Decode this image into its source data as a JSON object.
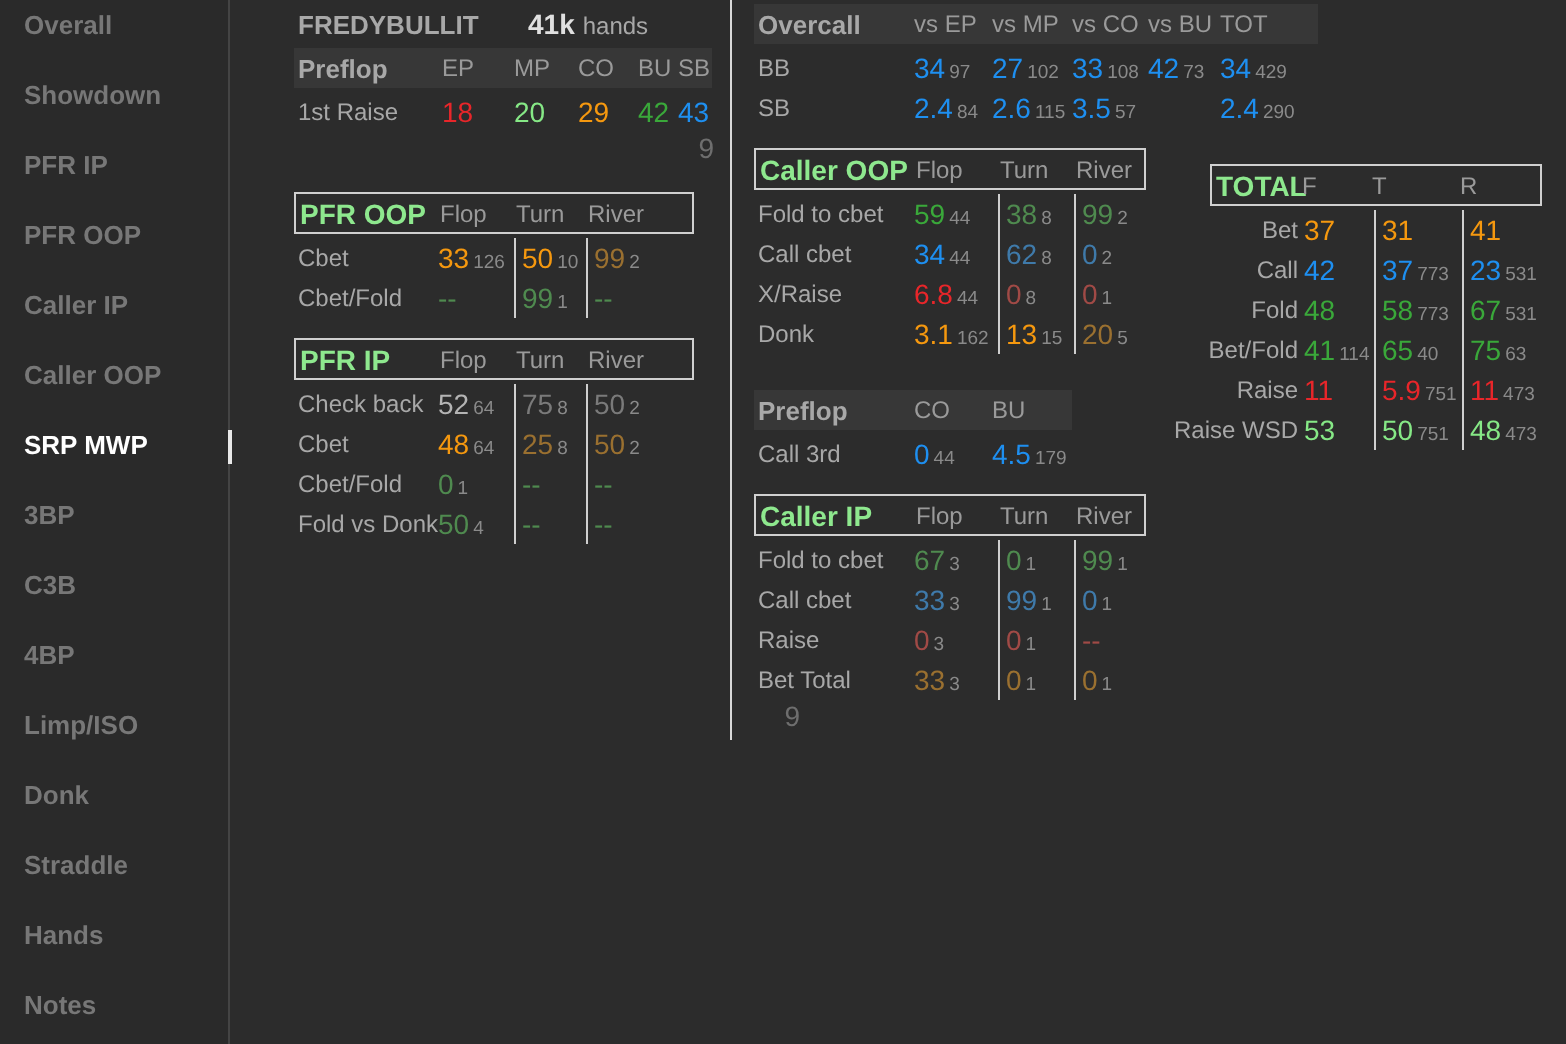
{
  "sidebar": {
    "items": [
      {
        "label": "Overall",
        "selected": false
      },
      {
        "label": "Showdown",
        "selected": false
      },
      {
        "label": "PFR IP",
        "selected": false
      },
      {
        "label": "PFR OOP",
        "selected": false
      },
      {
        "label": "Caller IP",
        "selected": false
      },
      {
        "label": "Caller OOP",
        "selected": false
      },
      {
        "label": "SRP MWP",
        "selected": true
      },
      {
        "label": "3BP",
        "selected": false
      },
      {
        "label": "C3B",
        "selected": false
      },
      {
        "label": "4BP",
        "selected": false
      },
      {
        "label": "Limp/ISO",
        "selected": false
      },
      {
        "label": "Donk",
        "selected": false
      },
      {
        "label": "Straddle",
        "selected": false
      },
      {
        "label": "Hands",
        "selected": false
      },
      {
        "label": "Notes",
        "selected": false
      }
    ]
  },
  "player": {
    "name": "FREDYBULLIT",
    "hands_count": "41k",
    "hands_label": "hands"
  },
  "columns": [
    {
      "sections": [
        {
          "kind": "grid",
          "title": "Preflop",
          "columns": [
            "EP",
            "MP",
            "CO",
            "BU",
            "SB"
          ],
          "rows": [
            {
              "label": "1st Raise",
              "cells": [
                {
                  "value": "18",
                  "color": "#e8262a"
                },
                {
                  "value": "20",
                  "color": "#86e886"
                },
                {
                  "value": "29",
                  "color": "#f5980f"
                },
                {
                  "value": "42",
                  "color": "#3aa83a"
                },
                {
                  "value": "43",
                  "color": "#1e8ff0"
                }
              ]
            }
          ]
        },
        {
          "kind": "stray",
          "text": "9"
        },
        {
          "kind": "street",
          "title": "PFR OOP",
          "columns": [
            "Flop",
            "Turn",
            "River"
          ],
          "rows": [
            {
              "label": "Cbet",
              "cells": [
                {
                  "value": "33",
                  "sample": "126",
                  "color": "#f5980f"
                },
                {
                  "value": "50",
                  "sample": "10",
                  "color": "#f5980f"
                },
                {
                  "value": "99",
                  "sample": "2",
                  "color": "#9a7030"
                }
              ]
            },
            {
              "label": "Cbet/Fold",
              "cells": [
                {
                  "value": "--",
                  "color": "#4f8a4f"
                },
                {
                  "value": "99",
                  "sample": "1",
                  "color": "#4f8a4f"
                },
                {
                  "value": "--",
                  "color": "#4f8a4f"
                }
              ]
            }
          ]
        },
        {
          "kind": "street",
          "title": "PFR IP",
          "columns": [
            "Flop",
            "Turn",
            "River"
          ],
          "rows": [
            {
              "label": "Check back",
              "cells": [
                {
                  "value": "52",
                  "sample": "64",
                  "color": "#b4b4b4"
                },
                {
                  "value": "75",
                  "sample": "8",
                  "color": "#7a7a7a"
                },
                {
                  "value": "50",
                  "sample": "2",
                  "color": "#7a7a7a"
                }
              ]
            },
            {
              "label": "Cbet",
              "cells": [
                {
                  "value": "48",
                  "sample": "64",
                  "color": "#f5980f"
                },
                {
                  "value": "25",
                  "sample": "8",
                  "color": "#9a7030"
                },
                {
                  "value": "50",
                  "sample": "2",
                  "color": "#9a7030"
                }
              ]
            },
            {
              "label": "Cbet/Fold",
              "cells": [
                {
                  "value": "0",
                  "sample": "1",
                  "color": "#4f8a4f"
                },
                {
                  "value": "--",
                  "color": "#4f8a4f"
                },
                {
                  "value": "--",
                  "color": "#4f8a4f"
                }
              ]
            },
            {
              "label": "Fold vs Donk",
              "cells": [
                {
                  "value": "50",
                  "sample": "4",
                  "color": "#4f8a4f"
                },
                {
                  "value": "--",
                  "color": "#4f8a4f"
                },
                {
                  "value": "--",
                  "color": "#4f8a4f"
                }
              ]
            }
          ]
        }
      ]
    },
    {
      "sections": [
        {
          "kind": "grid",
          "title": "Overcall",
          "columns": [
            "vs EP",
            "vs MP",
            "vs CO",
            "vs BU",
            "TOT"
          ],
          "rows": [
            {
              "label": "BB",
              "cells": [
                {
                  "value": "34",
                  "sample": "97",
                  "color": "#1e8ff0"
                },
                {
                  "value": "27",
                  "sample": "102",
                  "color": "#1e8ff0"
                },
                {
                  "value": "33",
                  "sample": "108",
                  "color": "#1e8ff0"
                },
                {
                  "value": "42",
                  "sample": "73",
                  "color": "#1e8ff0"
                },
                {
                  "value": "34",
                  "sample": "429",
                  "color": "#1e8ff0"
                }
              ]
            },
            {
              "label": "SB",
              "cells": [
                {
                  "value": "2.4",
                  "sample": "84",
                  "color": "#1e8ff0"
                },
                {
                  "value": "2.6",
                  "sample": "115",
                  "color": "#1e8ff0"
                },
                {
                  "value": "3.5",
                  "sample": "57",
                  "color": "#1e8ff0"
                },
                null,
                {
                  "value": "2.4",
                  "sample": "290",
                  "color": "#1e8ff0"
                }
              ]
            }
          ]
        },
        {
          "kind": "street",
          "title": "Caller OOP",
          "columns": [
            "Flop",
            "Turn",
            "River"
          ],
          "rows": [
            {
              "label": "Fold to cbet",
              "cells": [
                {
                  "value": "59",
                  "sample": "44",
                  "color": "#3aa83a"
                },
                {
                  "value": "38",
                  "sample": "8",
                  "color": "#4f8a4f"
                },
                {
                  "value": "99",
                  "sample": "2",
                  "color": "#4f8a4f"
                }
              ]
            },
            {
              "label": "Call cbet",
              "cells": [
                {
                  "value": "34",
                  "sample": "44",
                  "color": "#1e8ff0"
                },
                {
                  "value": "62",
                  "sample": "8",
                  "color": "#3f7aaa"
                },
                {
                  "value": "0",
                  "sample": "2",
                  "color": "#3f7aaa"
                }
              ]
            },
            {
              "label": "X/Raise",
              "cells": [
                {
                  "value": "6.8",
                  "sample": "44",
                  "color": "#e8262a"
                },
                {
                  "value": "0",
                  "sample": "8",
                  "color": "#a04a46"
                },
                {
                  "value": "0",
                  "sample": "1",
                  "color": "#a04a46"
                }
              ]
            },
            {
              "label": "Donk",
              "cells": [
                {
                  "value": "3.1",
                  "sample": "162",
                  "color": "#f5980f"
                },
                {
                  "value": "13",
                  "sample": "15",
                  "color": "#f5980f"
                },
                {
                  "value": "20",
                  "sample": "5",
                  "color": "#9a7030"
                }
              ]
            }
          ]
        },
        {
          "kind": "grid",
          "title": "Preflop",
          "columns": [
            "CO",
            "BU"
          ],
          "rows": [
            {
              "label": "Call 3rd",
              "cells": [
                {
                  "value": "0",
                  "sample": "44",
                  "color": "#1e8ff0"
                },
                {
                  "value": "4.5",
                  "sample": "179",
                  "color": "#1e8ff0"
                }
              ]
            }
          ]
        },
        {
          "kind": "street",
          "title": "Caller IP",
          "columns": [
            "Flop",
            "Turn",
            "River"
          ],
          "rows": [
            {
              "label": "Fold to cbet",
              "cells": [
                {
                  "value": "67",
                  "sample": "3",
                  "color": "#4f8a4f"
                },
                {
                  "value": "0",
                  "sample": "1",
                  "color": "#4f8a4f"
                },
                {
                  "value": "99",
                  "sample": "1",
                  "color": "#4f8a4f"
                }
              ]
            },
            {
              "label": "Call cbet",
              "cells": [
                {
                  "value": "33",
                  "sample": "3",
                  "color": "#3f7aaa"
                },
                {
                  "value": "99",
                  "sample": "1",
                  "color": "#3f7aaa"
                },
                {
                  "value": "0",
                  "sample": "1",
                  "color": "#3f7aaa"
                }
              ]
            },
            {
              "label": "Raise",
              "cells": [
                {
                  "value": "0",
                  "sample": "3",
                  "color": "#a04a46"
                },
                {
                  "value": "0",
                  "sample": "1",
                  "color": "#a04a46"
                },
                {
                  "value": "--",
                  "color": "#a04a46"
                }
              ]
            },
            {
              "label": "Bet Total",
              "cells": [
                {
                  "value": "33",
                  "sample": "3",
                  "color": "#9a7030"
                },
                {
                  "value": "0",
                  "sample": "1",
                  "color": "#9a7030"
                },
                {
                  "value": "0",
                  "sample": "1",
                  "color": "#9a7030"
                }
              ]
            }
          ]
        },
        {
          "kind": "stray",
          "text": "9"
        }
      ]
    },
    {
      "sections": [
        {
          "kind": "total",
          "title": "TOTAL",
          "columns": [
            "F",
            "T",
            "R"
          ],
          "rows": [
            {
              "label": "Bet",
              "cells": [
                {
                  "value": "37",
                  "color": "#f5980f"
                },
                {
                  "value": "31",
                  "color": "#f5980f"
                },
                {
                  "value": "41",
                  "color": "#f5980f"
                }
              ]
            },
            {
              "label": "Call",
              "cells": [
                {
                  "value": "42",
                  "color": "#1e8ff0"
                },
                {
                  "value": "37",
                  "sample": "773",
                  "color": "#1e8ff0"
                },
                {
                  "value": "23",
                  "sample": "531",
                  "color": "#1e8ff0"
                }
              ]
            },
            {
              "label": "Fold",
              "cells": [
                {
                  "value": "48",
                  "color": "#3aa83a"
                },
                {
                  "value": "58",
                  "sample": "773",
                  "color": "#3aa83a"
                },
                {
                  "value": "67",
                  "sample": "531",
                  "color": "#3aa83a"
                }
              ]
            },
            {
              "label": "Bet/Fold",
              "cells": [
                {
                  "value": "41",
                  "sample": "114",
                  "color": "#3aa83a"
                },
                {
                  "value": "65",
                  "sample": "40",
                  "color": "#3aa83a"
                },
                {
                  "value": "75",
                  "sample": "63",
                  "color": "#3aa83a"
                }
              ]
            },
            {
              "label": "Raise",
              "cells": [
                {
                  "value": "11",
                  "color": "#e8262a"
                },
                {
                  "value": "5.9",
                  "sample": "751",
                  "color": "#e8262a"
                },
                {
                  "value": "11",
                  "sample": "473",
                  "color": "#e8262a"
                }
              ]
            },
            {
              "label": "Raise WSD",
              "cells": [
                {
                  "value": "53",
                  "color": "#86e886"
                },
                {
                  "value": "50",
                  "sample": "751",
                  "color": "#86e886"
                },
                {
                  "value": "48",
                  "sample": "473",
                  "color": "#86e886"
                }
              ]
            }
          ]
        }
      ]
    }
  ]
}
